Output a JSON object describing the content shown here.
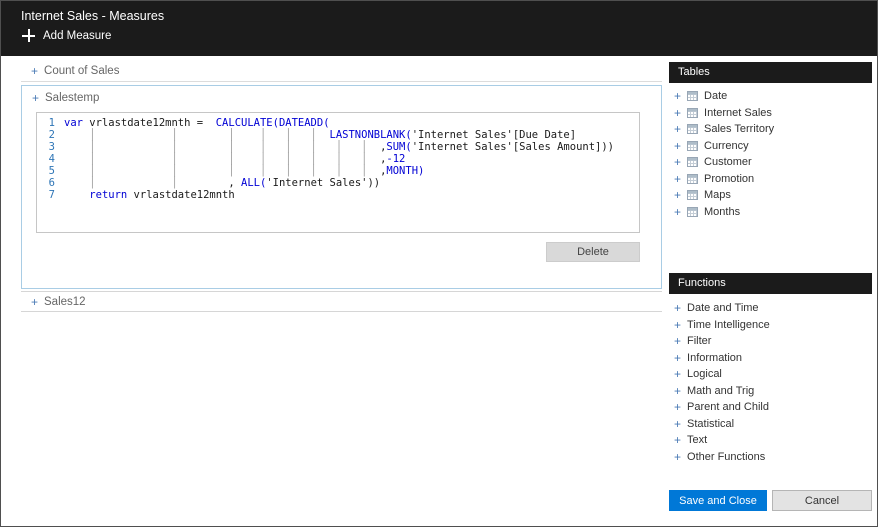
{
  "header": {
    "title": "Internet Sales - Measures",
    "add_measure_label": "Add Measure"
  },
  "measures": {
    "count_of_sales": {
      "expander": "+",
      "label": "Count of Sales"
    },
    "salestemp": {
      "expander": "+",
      "label": "Salestemp"
    },
    "sales12": {
      "expander": "+",
      "label": "Sales12"
    }
  },
  "editor": {
    "delete_label": "Delete",
    "lines": [
      {
        "num": "1",
        "segments": [
          {
            "t": "var",
            "c": "k"
          },
          {
            "t": " vrlastdate12mnth =  ",
            "c": "p"
          },
          {
            "t": "CALCULATE(DATEADD(",
            "c": "k"
          }
        ]
      },
      {
        "num": "2",
        "segments": [
          {
            "t": "    │            │        │    │   │   │  ",
            "c": "g"
          },
          {
            "t": "LASTNONBLANK(",
            "c": "k"
          },
          {
            "t": "'Internet Sales'[Due Date]",
            "c": "p"
          }
        ]
      },
      {
        "num": "3",
        "segments": [
          {
            "t": "    │            │        │    │   │   │   │   │  ",
            "c": "g"
          },
          {
            "t": ",",
            "c": "p"
          },
          {
            "t": "SUM(",
            "c": "k"
          },
          {
            "t": "'Internet Sales'[Sales Amount]))",
            "c": "p"
          }
        ]
      },
      {
        "num": "4",
        "segments": [
          {
            "t": "    │            │        │    │   │   │   │   │  ",
            "c": "g"
          },
          {
            "t": ",",
            "c": "p"
          },
          {
            "t": "-12",
            "c": "k"
          }
        ]
      },
      {
        "num": "5",
        "segments": [
          {
            "t": "    │            │        │    │   │   │   │   │  ",
            "c": "g"
          },
          {
            "t": ",",
            "c": "p"
          },
          {
            "t": "MONTH)",
            "c": "k"
          }
        ]
      },
      {
        "num": "6",
        "segments": [
          {
            "t": "    │            │        ",
            "c": "g"
          },
          {
            "t": ", ",
            "c": "p"
          },
          {
            "t": "ALL(",
            "c": "k"
          },
          {
            "t": "'Internet Sales'))",
            "c": "p"
          }
        ]
      },
      {
        "num": "7",
        "segments": [
          {
            "t": "    ",
            "c": "g"
          },
          {
            "t": "return",
            "c": "k"
          },
          {
            "t": " vrlastdate12mnth",
            "c": "p"
          }
        ]
      }
    ]
  },
  "sidebar": {
    "plus": "+",
    "tables": {
      "title": "Tables",
      "items": [
        "Date",
        "Internet Sales",
        "Sales Territory",
        "Currency",
        "Customer",
        "Promotion",
        "Maps",
        "Months"
      ]
    },
    "functions": {
      "title": "Functions",
      "items": [
        "Date and Time",
        "Time Intelligence",
        "Filter",
        "Information",
        "Logical",
        "Math and Trig",
        "Parent and Child",
        "Statistical",
        "Text",
        "Other Functions"
      ]
    }
  },
  "footer": {
    "save_label": "Save and Close",
    "cancel_label": "Cancel"
  },
  "colors": {
    "accent": "#0078d7",
    "keyword": "#0000d4",
    "line_number": "#2e75b6",
    "header_bg": "#1b1b1b"
  }
}
